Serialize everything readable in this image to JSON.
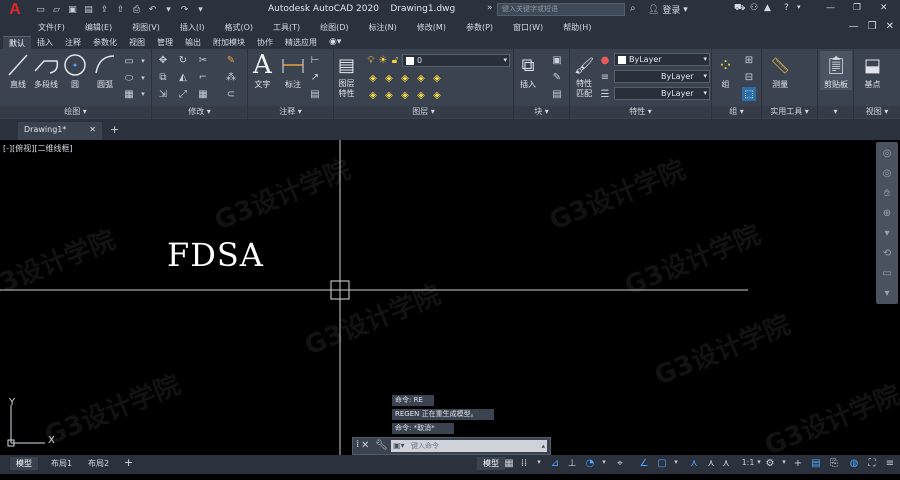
{
  "app": {
    "logo": "A",
    "title": "Autodesk AutoCAD 2020",
    "filename": "Drawing1.dwg"
  },
  "search": {
    "placeholder": "键入关键字或短语"
  },
  "account": {
    "login": "登录"
  },
  "menus": [
    "文件(F)",
    "编辑(E)",
    "视图(V)",
    "插入(I)",
    "格式(O)",
    "工具(T)",
    "绘图(D)",
    "标注(N)",
    "修改(M)",
    "参数(P)",
    "窗口(W)",
    "帮助(H)"
  ],
  "ribbon_tabs": [
    "默认",
    "插入",
    "注释",
    "参数化",
    "视图",
    "管理",
    "输出",
    "附加模块",
    "协作",
    "精选应用"
  ],
  "ribbon": {
    "draw": {
      "label": "绘图",
      "line": "直线",
      "polyline": "多段线",
      "circle": "圆",
      "arc": "圆弧"
    },
    "modify": {
      "label": "修改"
    },
    "annotation": {
      "label": "注释",
      "text": "文字",
      "dimension": "标注"
    },
    "layers": {
      "label": "图层",
      "props": "图层\n特性",
      "layer_value": "0"
    },
    "block": {
      "label": "块",
      "insert": "插入"
    },
    "properties": {
      "label": "特性",
      "match": "特性\n匹配",
      "color": "ByLayer",
      "linetype": "ByLayer",
      "lineweight": "ByLayer"
    },
    "groups": {
      "label": "组",
      "group": "组"
    },
    "utilities": {
      "label": "实用工具",
      "measure": "测量"
    },
    "clipboard": {
      "label": "剪贴板",
      "paste": "剪贴板"
    },
    "view": {
      "label": "视图",
      "base": "基点"
    }
  },
  "doc_tab": {
    "name": "Drawing1*"
  },
  "viewport": {
    "label": "[-][俯视][二维线框]"
  },
  "drawing_text": "FDSA",
  "watermark": "G3设计学院",
  "command_history": [
    "命令: RE",
    "REGEN 正在重生成模型。",
    "命令: *取消*"
  ],
  "command_input": {
    "placeholder": "键入命令"
  },
  "layout_tabs": [
    "模型",
    "布局1",
    "布局2"
  ],
  "status": {
    "model": "模型",
    "scale": "1:1"
  },
  "ucs": {
    "x": "X",
    "y": "Y"
  }
}
